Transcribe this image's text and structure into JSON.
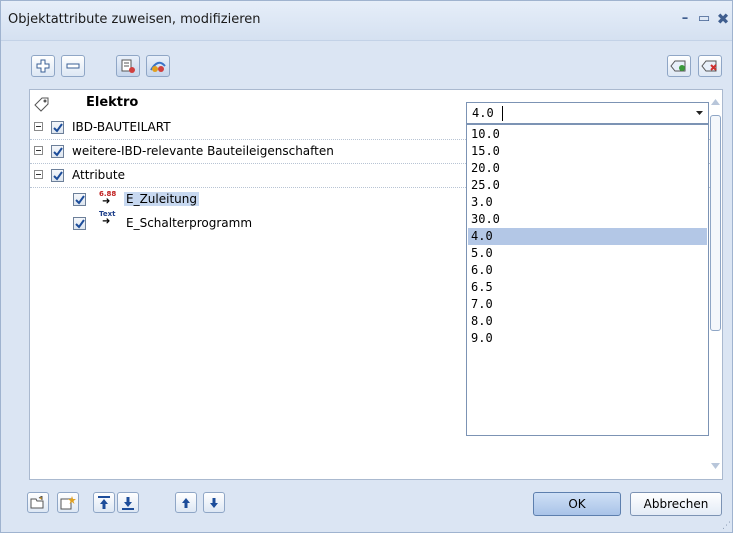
{
  "window": {
    "title": "Objektattribute zuweisen, modifizieren",
    "controls": {
      "minimize": "–",
      "maximize": "▭",
      "close": "✖"
    }
  },
  "toolbar": {
    "buttons": [
      "add-icon",
      "remove-icon",
      "attribute-list-icon",
      "attribute-favorite-icon"
    ],
    "right_buttons": [
      "tag-add-icon",
      "tag-remove-icon"
    ]
  },
  "tree": {
    "root": {
      "label": "Elektro",
      "icon": "tag-icon"
    },
    "groups": [
      {
        "label": "IBD-BAUTEILART",
        "checked": true,
        "expanded": true
      },
      {
        "label": "weitere-IBD-relevante Bauteileigenschaften",
        "checked": true,
        "expanded": true
      },
      {
        "label": "Attribute",
        "checked": true,
        "expanded": true
      }
    ],
    "attributes": [
      {
        "label": "E_Zuleitung",
        "type_icon": "numeric-attribute-icon",
        "type_glyph": "6.88",
        "checked": true,
        "selected": true
      },
      {
        "label": "E_Schalterprogramm",
        "type_icon": "text-attribute-icon",
        "type_glyph": "Text",
        "checked": true,
        "selected": false
      }
    ]
  },
  "value_editor": {
    "current_value": "4.0",
    "options": [
      "10.0",
      "15.0",
      "20.0",
      "25.0",
      "3.0",
      "30.0",
      "4.0",
      "5.0",
      "6.0",
      "6.5",
      "7.0",
      "8.0",
      "9.0"
    ],
    "selected_option": "4.0"
  },
  "bottom_toolbar": {
    "buttons": [
      "open-folder-icon",
      "new-attribute-icon",
      "move-top-icon",
      "move-bottom-icon",
      "move-up-icon",
      "move-down-icon"
    ]
  },
  "actions": {
    "ok_label": "OK",
    "cancel_label": "Abbrechen"
  }
}
